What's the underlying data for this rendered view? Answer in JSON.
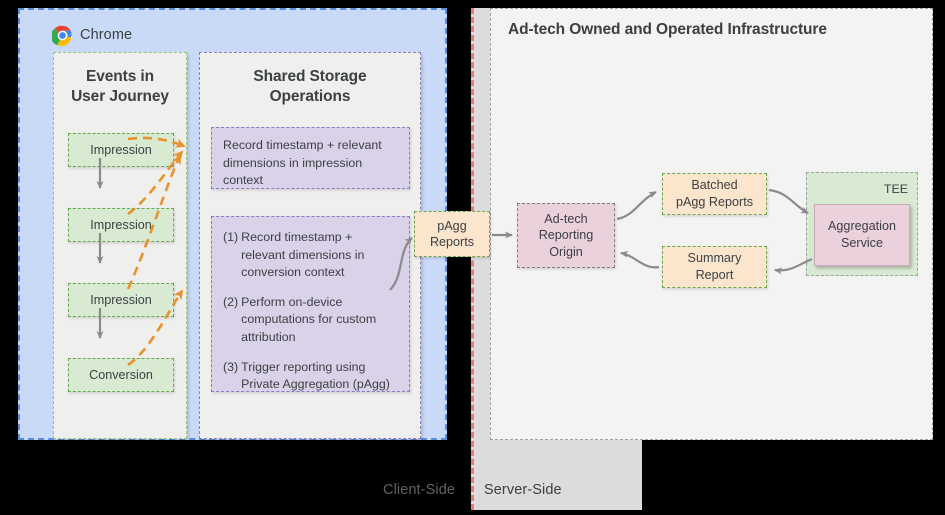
{
  "client": {
    "browser_label": "Chrome",
    "browser_icon": "chrome-logo-icon",
    "side_label": "Client-Side",
    "events_panel": {
      "title": "Events in\nUser Journey",
      "title_line1": "Events in",
      "title_line2": "User Journey",
      "events": [
        {
          "label": "Impression"
        },
        {
          "label": "Impression"
        },
        {
          "label": "Impression"
        },
        {
          "label": "Conversion"
        }
      ]
    },
    "shared_storage_panel": {
      "title_line1": "Shared Storage",
      "title_line2": "Operations",
      "operations": [
        {
          "id": "impression-context-op",
          "text": "Record timestamp + relevant dimensions in impression context"
        },
        {
          "id": "conversion-context-op",
          "items": [
            {
              "num": "(1)",
              "text": "Record timestamp + relevant dimensions in conversion context"
            },
            {
              "num": "(2)",
              "text": "Perform on-device computations for custom attribution"
            },
            {
              "num": "(3)",
              "text": "Trigger reporting using Private Aggregation (pAgg)"
            }
          ]
        }
      ]
    }
  },
  "bridge": {
    "pagg_reports_line1": "pAgg",
    "pagg_reports_line2": "Reports"
  },
  "server": {
    "side_label": "Server-Side",
    "title": "Ad-tech Owned and Operated Infrastructure",
    "nodes": {
      "reporting_origin_line1": "Ad-tech",
      "reporting_origin_line2": "Reporting",
      "reporting_origin_line3": "Origin",
      "batched_reports_line1": "Batched",
      "batched_reports_line2": "pAgg Reports",
      "summary_report_line1": "Summary",
      "summary_report_line2": "Report",
      "tee_label": "TEE",
      "aggregation_service_line1": "Aggregation",
      "aggregation_service_line2": "Service"
    }
  },
  "colors": {
    "client_panel_fill": "#c9daf8",
    "client_panel_border": "#5b8ddb",
    "server_panel_fill": "#dcdcdc",
    "server_divider": "#ea7b72",
    "event_fill": "#d9ead3",
    "event_border": "#6aa84f",
    "operation_fill": "#d9d2e9",
    "operation_border": "#8e7cc3",
    "report_fill": "#fce5cd",
    "report_border": "#6aa84f",
    "adtech_fill": "#ead1dc",
    "tee_fill": "#d9ead3",
    "dashed_arrow": "#e8912d",
    "solid_arrow": "#8a8a8a",
    "text": "#3c4043"
  }
}
